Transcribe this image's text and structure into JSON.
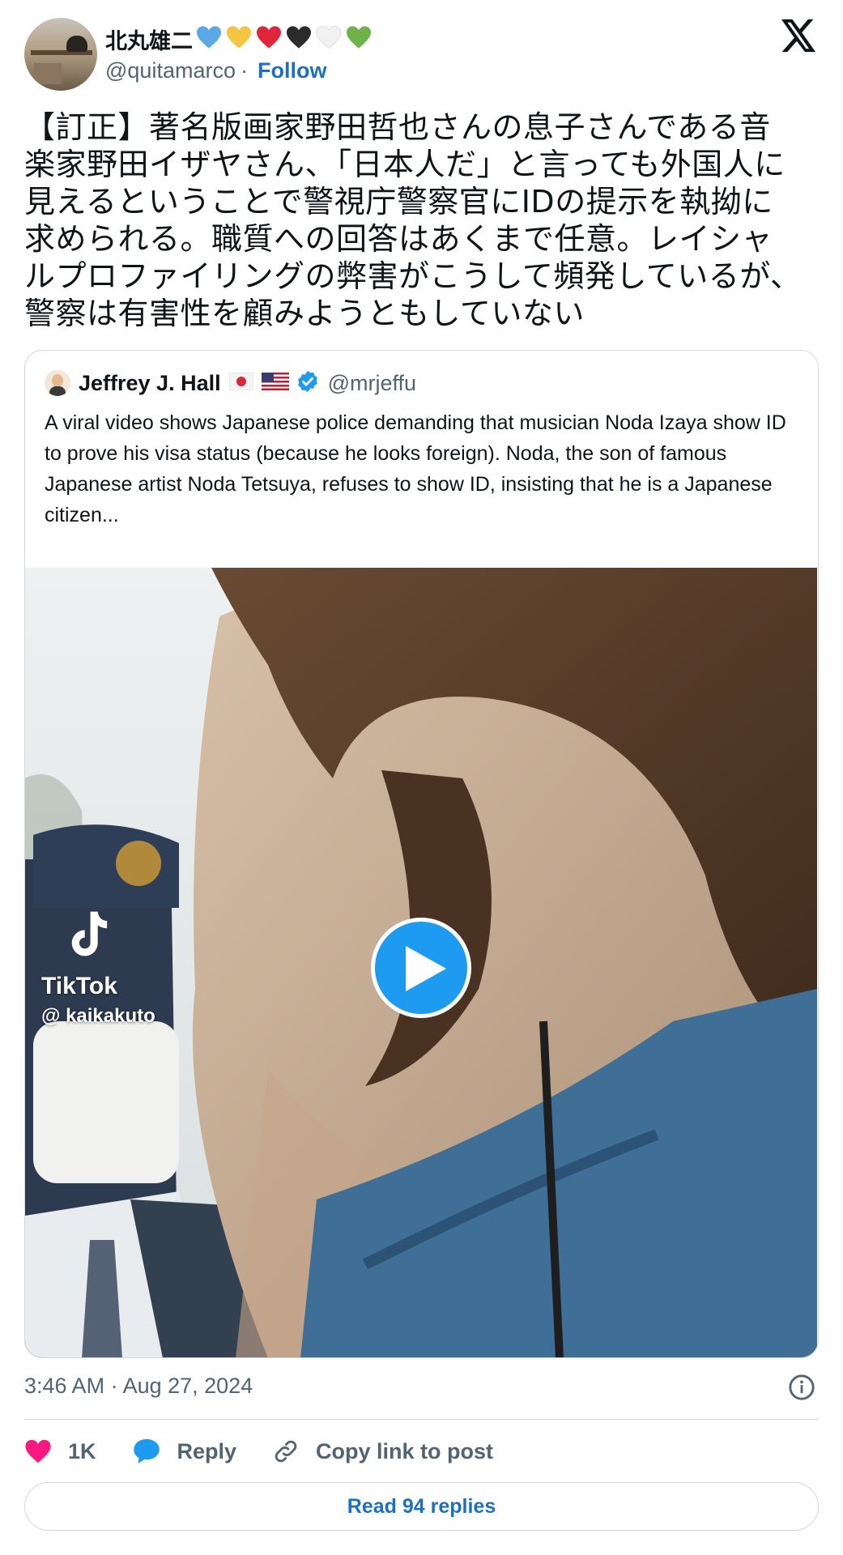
{
  "author": {
    "display_name": "北丸雄二",
    "hearts": [
      "#5aa9e6",
      "#f4c542",
      "#e0263b",
      "#2b2b2b",
      "#f2f2f2",
      "#6fb24a"
    ],
    "handle": "@quitamarco",
    "separator": "·",
    "follow_label": "Follow"
  },
  "tweet": {
    "text": "【訂正】著名版画家野田哲也さんの息子さんである音楽家野田イザヤさん、「日本人だ」と言っても外国人に見えるということで警視庁警察官にIDの提示を執拗に求められる。職質への回答はあくまで任意。レイシャルプロファイリングの弊害がこうして頻発しているが、警察は有害性を顧みようともしていない"
  },
  "quote": {
    "name": "Jeffrey J. Hall",
    "handle": "@mrjeffu",
    "text": "A viral video shows Japanese police demanding that musician Noda Izaya show ID to prove his visa status (because he looks foreign). Noda, the son of famous Japanese artist Noda Tetsuya, refuses to show ID, insisting that he is a Japanese citizen...",
    "media": {
      "watermark_brand": "TikTok",
      "watermark_user": "@ kaikakuto"
    }
  },
  "footer": {
    "timestamp": "3:46 AM · Aug 27, 2024",
    "likes": "1K",
    "reply_label": "Reply",
    "copy_label": "Copy link to post",
    "read_replies_label": "Read 94 replies"
  },
  "colors": {
    "like": "#f91880",
    "link": "#1d6fbf",
    "accent": "#1d9bf0"
  }
}
